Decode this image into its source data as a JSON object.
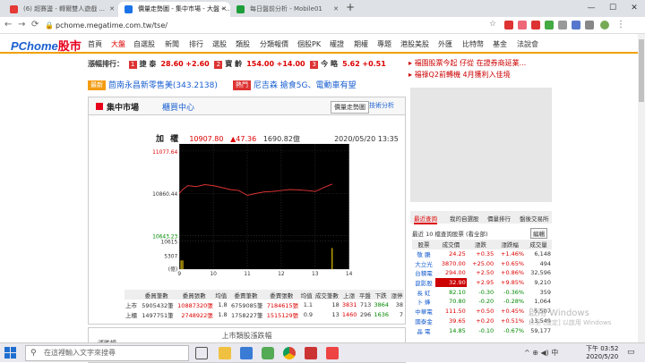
{
  "browser": {
    "tabs": [
      {
        "title": "(6) 超賽盪 - 轉爾雙人遊戲 ...",
        "active": false,
        "color": "#e53935"
      },
      {
        "title": "價量走勢圖 - 集中市場 - 大盤 - ...",
        "active": true,
        "color": "#1a73e8"
      },
      {
        "title": "每日盤前分析 - Mobile01",
        "active": false,
        "color": "#1e9e3a"
      }
    ],
    "url": "pchome.megatime.com.tw/tse/"
  },
  "site": {
    "logo_main": "PChome",
    "logo_sub": "股市",
    "nav": [
      "首頁",
      "大盤",
      "自選股",
      "新聞",
      "排行",
      "選股",
      "類股",
      "分類報價",
      "個股PK",
      "權證",
      "期權",
      "專題",
      "港股美股",
      "外匯",
      "比特幣",
      "基金",
      "法說會"
    ]
  },
  "rank": {
    "label": "漲幅排行：",
    "items": [
      {
        "no": "1",
        "name": "捷 泰",
        "price": "28.60",
        "chg": "+2.60"
      },
      {
        "no": "2",
        "name": "寶 齡",
        "price": "154.00",
        "chg": "+14.00"
      },
      {
        "no": "3",
        "name": "今 略",
        "price": "5.62",
        "chg": "+0.51"
      }
    ]
  },
  "promo": {
    "badge1": "最新",
    "link1": "茴南永昌新零售美(343.2138)",
    "badge2": "熱門",
    "link2": "尼吉森 搶食5G、電動車有望"
  },
  "panel": {
    "title": "集中市場",
    "subtitle": "櫃買中心",
    "btn_active": "價量走勢圖",
    "btn_other": "技術分析",
    "index_name": "加 權",
    "index_value": "10907.80",
    "index_change": "▲47.36",
    "volume": "1690.82億",
    "datetime": "2020/05/20 13:35"
  },
  "chart_data": {
    "type": "line",
    "title": "加權",
    "price_ticks": [
      "11077.64",
      "10860.44",
      "10643.23"
    ],
    "volume_ticks": [
      "10615",
      "5307"
    ],
    "volume_unit": "(億)",
    "x_ticks": [
      "9",
      "10",
      "11",
      "12",
      "13",
      "14"
    ],
    "ylim": [
      10643.23,
      11077.64
    ],
    "ref_line": 10860.44,
    "series": [
      {
        "x": [
          9.0,
          9.1,
          9.25,
          9.5,
          9.75,
          10.0,
          10.25,
          10.5,
          10.75,
          11.0,
          11.25,
          11.5,
          11.75,
          12.0,
          12.25,
          12.5,
          12.75,
          13.0,
          13.25,
          13.5
        ],
        "values": [
          10860,
          10880,
          10900,
          10895,
          10905,
          10900,
          10890,
          10880,
          10875,
          10850,
          10860,
          10868,
          10870,
          10875,
          10880,
          10878,
          10875,
          10870,
          10890,
          10908
        ]
      }
    ],
    "volume": [
      9.05,
      9.1,
      13.5
    ]
  },
  "stats": {
    "headers": [
      "",
      "委買筆數",
      "委買張數",
      "均值",
      "委賣筆數",
      "委賣張數",
      "均值",
      "成交筆數",
      "上漲",
      "平盤",
      "下跌",
      "漲停"
    ],
    "rows": [
      [
        "上市",
        "5905432筆",
        "10887320張",
        "1.8",
        "6759085筆",
        "7184615張",
        "1.1",
        "18",
        "3831",
        "713",
        "3864",
        "38"
      ],
      [
        "上櫃",
        "1497751筆",
        "2748922張",
        "1.8",
        "1758227筆",
        "1515129張",
        "0.9",
        "13",
        "1460",
        "296",
        "1636",
        "7"
      ]
    ]
  },
  "sub": {
    "title": "上市類股漲跌幅",
    "label": "漲跌幅"
  },
  "right": {
    "ads": [
      "福園股票今起 仔從 在證券商延業...",
      "福祿Q2前轉機 4月獲利入佳境"
    ],
    "tabs": [
      "最近查詢",
      "我的自選股",
      "價量排行",
      "盤後交易所"
    ],
    "recent_label": "最近 10 檔查詢股票 (看全部)",
    "edit_label": "編輯",
    "table_headers": [
      "股票",
      "成交價",
      "漲跌",
      "漲跌幅",
      "成交量"
    ],
    "rows": [
      [
        "敬 鵬",
        "24.25",
        "+0.35",
        "+1.46%",
        "6,148"
      ],
      [
        "大立光",
        "3870.00",
        "+25.00",
        "+0.65%",
        "494"
      ],
      [
        "台積電",
        "294.00",
        "+2.50",
        "+0.86%",
        "32,596"
      ],
      [
        "崑影股",
        "32.90",
        "+2.95",
        "+9.85%",
        "9,210"
      ],
      [
        "長 虹",
        "82.10",
        "-0.30",
        "-0.36%",
        "359"
      ],
      [
        "卜 蜂",
        "70.80",
        "-0.20",
        "-0.28%",
        "1,064"
      ],
      [
        "中華電",
        "111.50",
        "+0.50",
        "+0.45%",
        "5,507"
      ],
      [
        "國泰金",
        "39.65",
        "+0.20",
        "+0.51%",
        "13,549"
      ],
      [
        "晶 電",
        "14.85",
        "-0.10",
        "-0.67%",
        "59,177"
      ]
    ]
  },
  "watermark": {
    "line1": "啟用 Windows",
    "line2": "移至 [設定] 以啟用 Windows"
  },
  "taskbar": {
    "search_placeholder": "在這裡輸入文字來搜尋",
    "tray_text": "^ ⊕ ◀) 中",
    "time": "下午 03:52",
    "date": "2020/5/20"
  }
}
